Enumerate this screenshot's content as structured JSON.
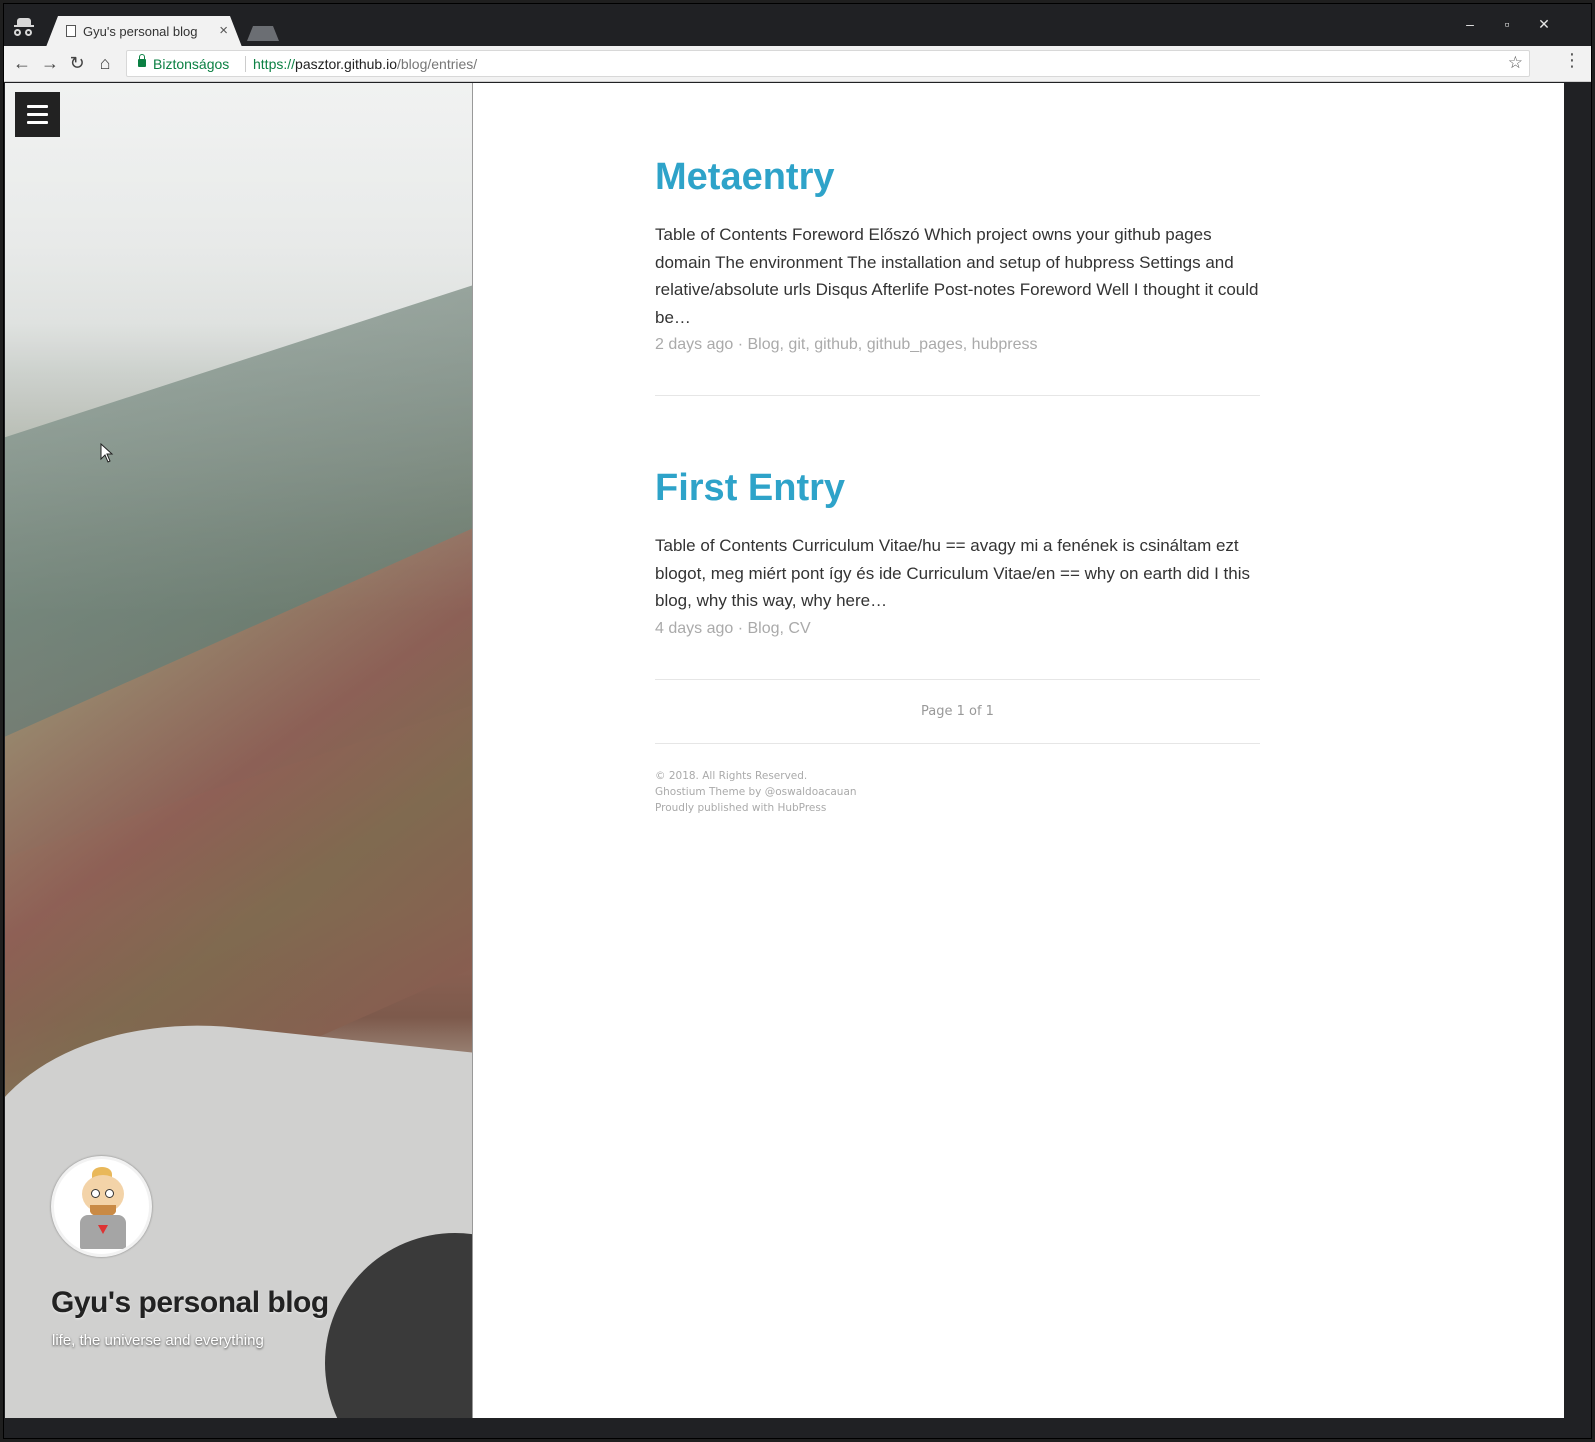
{
  "browser": {
    "tab_title": "Gyu's personal blog",
    "secure_label": "Biztonságos",
    "url_scheme": "https://",
    "url_host": "pasztor.github.io",
    "url_path": "/blog/entries/"
  },
  "site": {
    "title": "Gyu's personal blog",
    "description": "life, the universe and everything"
  },
  "posts": [
    {
      "title": "Metaentry",
      "excerpt": "Table of Contents Foreword Előszó Which project owns your github pages domain The environment The installation and setup of hubpress Settings and relative/absolute urls Disqus Afterlife Post-notes Foreword Well I thought it could be…",
      "date": "2 days ago",
      "separator": " · ",
      "tags": "Blog, git, github, github_pages, hubpress"
    },
    {
      "title": "First Entry",
      "excerpt": "Table of Contents Curriculum Vitae/hu == avagy mi a fenének is csináltam ezt blogot, meg miért pont így és ide Curriculum Vitae/en == why on earth did I this blog, why this way, why here…",
      "date": "4 days ago",
      "separator": " · ",
      "tags": "Blog, CV"
    }
  ],
  "pagination": "Page 1 of 1",
  "footer": {
    "copyright": "© 2018. All Rights Reserved.",
    "theme_prefix": "Ghostium Theme by ",
    "theme_author": "@oswaldoacauan",
    "published_prefix": "Proudly published with ",
    "published_link": "HubPress"
  },
  "colors": {
    "link": "#2ea3c9",
    "meta": "#aaaaaa",
    "secure": "#0b8043"
  }
}
